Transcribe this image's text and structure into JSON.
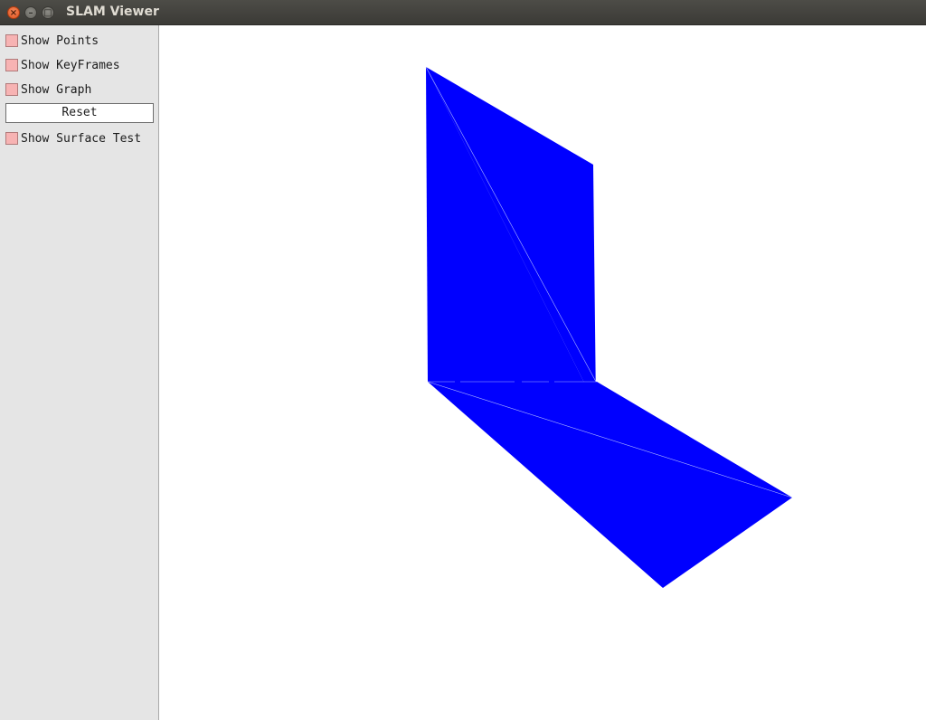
{
  "window": {
    "title": "SLAM Viewer"
  },
  "titlebar_buttons": {
    "close_glyph": "×",
    "minimize_glyph": "–",
    "maximize_glyph": "□",
    "close_icon": "close-icon",
    "minimize_icon": "minimize-icon",
    "maximize_icon": "maximize-icon"
  },
  "panel": {
    "items": [
      {
        "label": "Show Points",
        "checked": false
      },
      {
        "label": "Show KeyFrames",
        "checked": false
      },
      {
        "label": "Show Graph",
        "checked": false
      }
    ],
    "reset_label": "Reset",
    "surface_test": {
      "label": "Show Surface Test",
      "checked": false
    }
  },
  "viewport": {
    "background_color": "#ffffff",
    "mesh_color": "#0000ff",
    "edge_color": "#aab4ff"
  },
  "colors": {
    "checkbox_unchecked": "#f7b3b3",
    "panel_background": "#e5e5e5",
    "titlebar": "#3c3b37"
  }
}
